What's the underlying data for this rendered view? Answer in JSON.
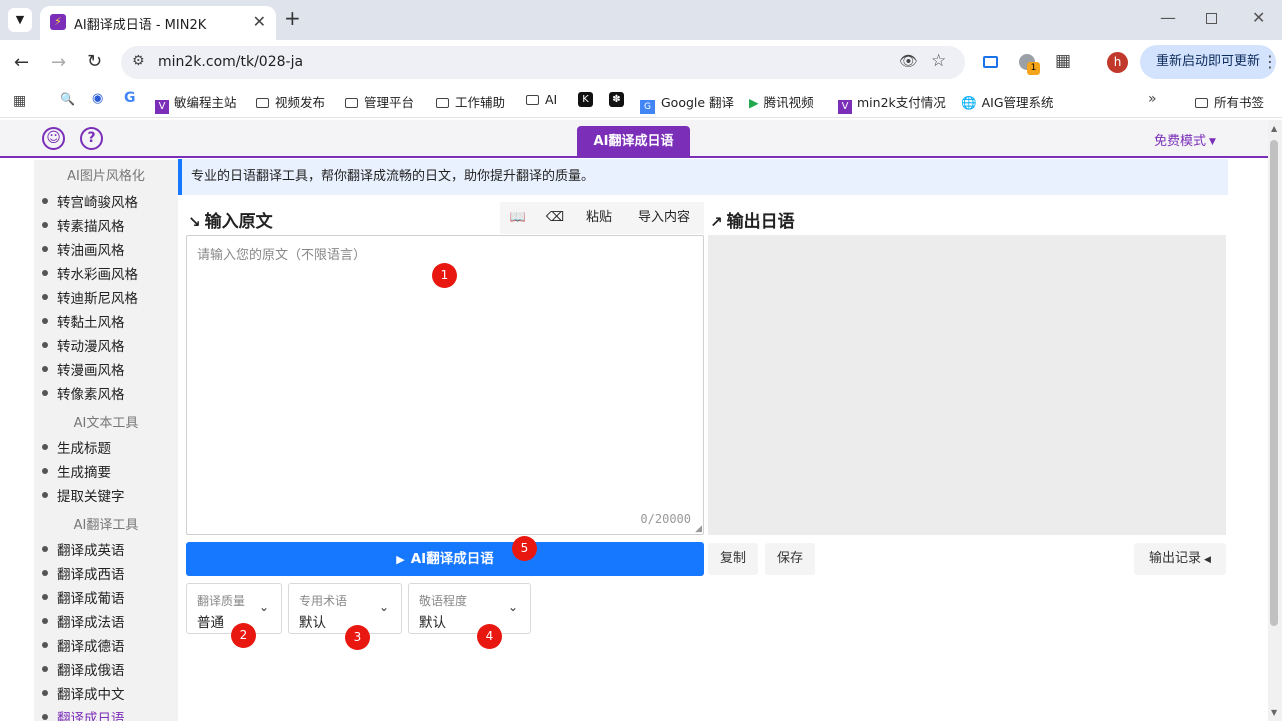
{
  "browser": {
    "tab_title": "AI翻译成日语 - MIN2K",
    "url": "min2k.com/tk/028-ja",
    "update_button": "重新启动即可更新",
    "profile_initial": "h",
    "extension_badge": "1"
  },
  "bookmarks": {
    "items": [
      "敏编程主站",
      "视频发布",
      "管理平台",
      "工作辅助",
      "AI",
      "Google 翻译",
      "腾讯视频",
      "min2k支付情况",
      "AIG管理系统"
    ],
    "all_bookmarks": "所有书签"
  },
  "page": {
    "title_tab": "AI翻译成日语",
    "mode": "免费模式",
    "description": "专业的日语翻译工具，帮你翻译成流畅的日文，助你提升翻译的质量。",
    "input_header": "输入原文",
    "output_header": "输出日语",
    "tools": [
      "粘贴",
      "导入内容"
    ],
    "input_placeholder": "请输入您的原文（不限语言）",
    "char_count": "0/20000",
    "run_button": "AI翻译成日语",
    "copy_button": "复制",
    "save_button": "保存",
    "history_button": "输出记录",
    "selects": [
      {
        "label": "翻译质量",
        "value": "普通"
      },
      {
        "label": "专用术语",
        "value": "默认"
      },
      {
        "label": "敬语程度",
        "value": "默认"
      }
    ],
    "badges": [
      "1",
      "2",
      "3",
      "4",
      "5"
    ]
  },
  "sidebar": {
    "section_image": "AI图片风格化",
    "image_items": [
      "转宫崎骏风格",
      "转素描风格",
      "转油画风格",
      "转水彩画风格",
      "转迪斯尼风格",
      "转黏土风格",
      "转动漫风格",
      "转漫画风格",
      "转像素风格"
    ],
    "section_text": "AI文本工具",
    "text_items": [
      "生成标题",
      "生成摘要",
      "提取关键字"
    ],
    "section_translate": "AI翻译工具",
    "translate_items": [
      "翻译成英语",
      "翻译成西语",
      "翻译成葡语",
      "翻译成法语",
      "翻译成德语",
      "翻译成俄语",
      "翻译成中文",
      "翻译成日语"
    ]
  },
  "colors": {
    "accent": "#7b2fb8",
    "primary": "#1677ff",
    "badge": "#e8170f"
  }
}
